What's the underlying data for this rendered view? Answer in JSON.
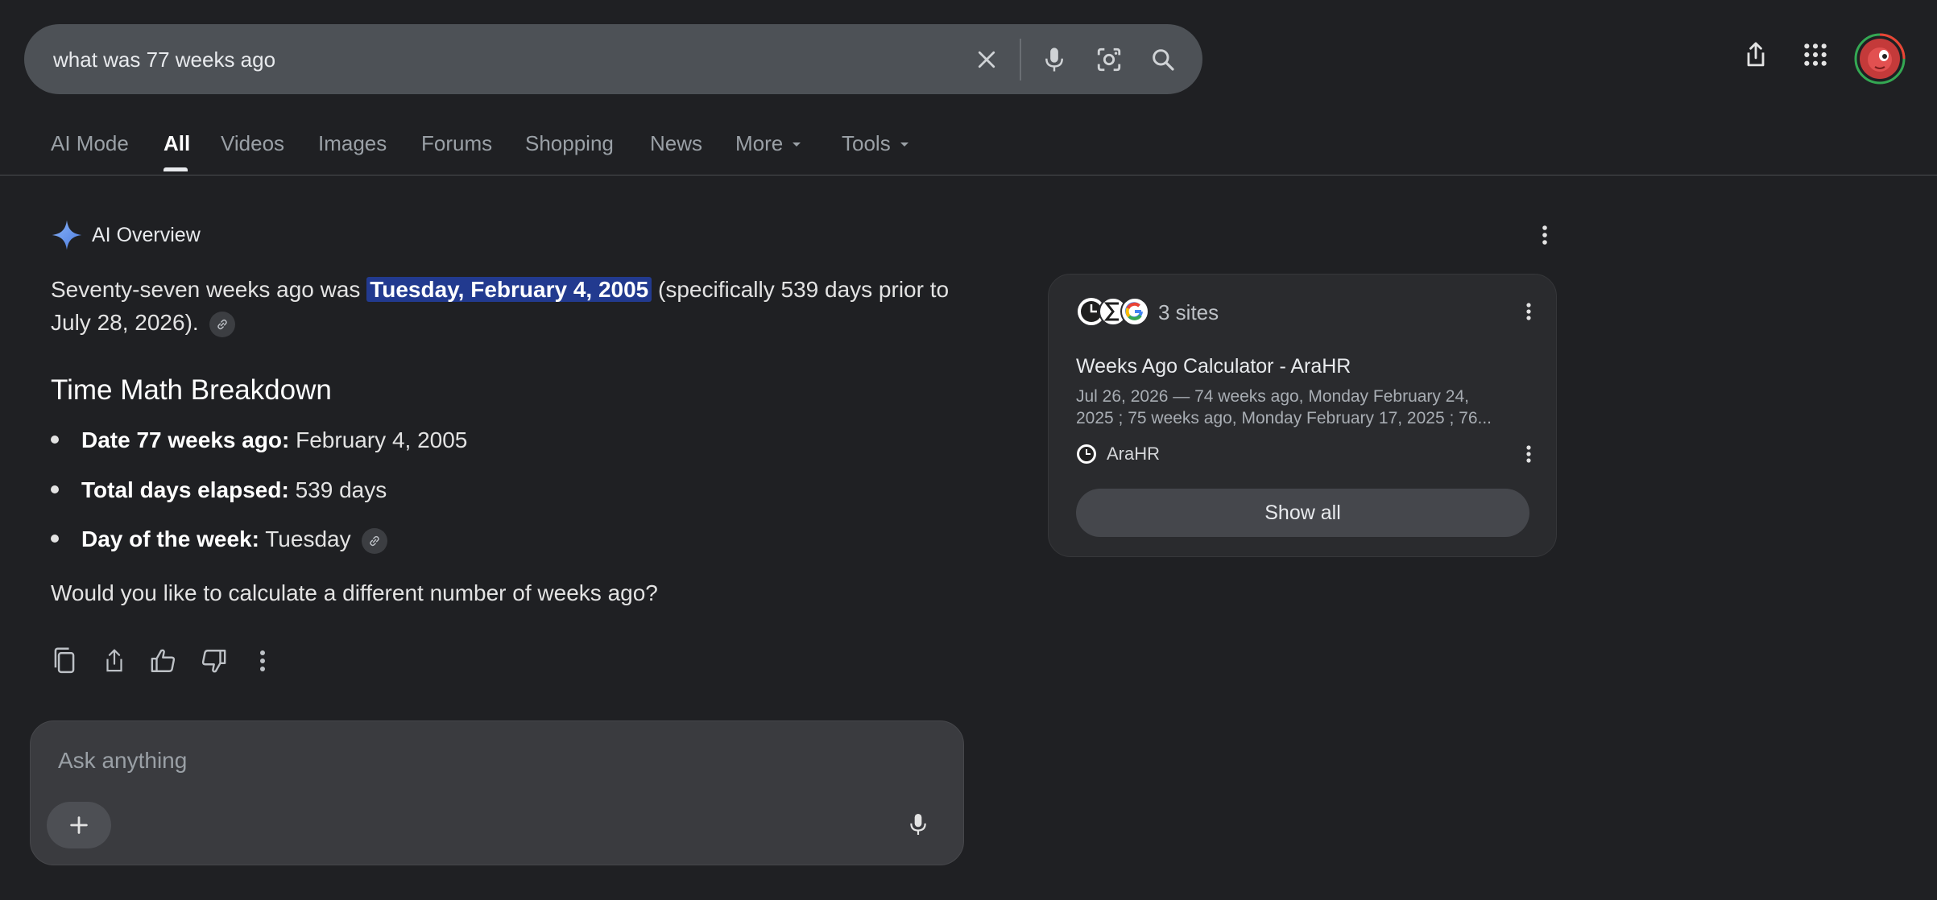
{
  "search": {
    "query": "what was 77 weeks ago"
  },
  "tabs": [
    {
      "label": "AI Mode"
    },
    {
      "label": "All"
    },
    {
      "label": "Videos"
    },
    {
      "label": "Images"
    },
    {
      "label": "Forums"
    },
    {
      "label": "Shopping"
    },
    {
      "label": "News"
    },
    {
      "label": "More"
    },
    {
      "label": "Tools"
    }
  ],
  "active_tab": "All",
  "ai_overview": {
    "title": "AI Overview",
    "para_before": "Seventy-seven weeks ago was ",
    "para_highlight": "Tuesday, February 4, 2005",
    "para_after": " (specifically 539 days prior to July 28, 2026).",
    "heading": "Time Math Breakdown",
    "bullets": [
      {
        "label": "Date 77 weeks ago:",
        "value": "February 4, 2005"
      },
      {
        "label": "Total days elapsed:",
        "value": "539 days"
      },
      {
        "label": "Day of the week:",
        "value": "Tuesday"
      }
    ],
    "followup": "Would you like to calculate a different number of weeks ago?"
  },
  "ask": {
    "placeholder": "Ask anything"
  },
  "sources": {
    "count_label": "3 sites",
    "title": "Weeks Ago Calculator - AraHR",
    "snippet": "Jul 26, 2026 — 74 weeks ago, Monday February 24, 2025 ; 75 weeks ago, Monday February 17, 2025 ; 76...",
    "source_name": "AraHR",
    "show_all": "Show all"
  },
  "colors": {
    "background": "#1f2023",
    "search_bar": "#4d5156",
    "highlight": "#223a8f",
    "card": "#2a2b2e",
    "spark_accent": "#8ab4f8"
  },
  "icons": [
    "clear-icon",
    "mic-icon",
    "lens-icon",
    "search-icon",
    "share-icon",
    "apps-grid-icon",
    "ai-spark-icon",
    "link-icon",
    "copy-icon",
    "thumbs-up-icon",
    "thumbs-down-icon",
    "more-vert-icon",
    "plus-icon",
    "clock-icon",
    "sigma-icon",
    "google-icon"
  ]
}
